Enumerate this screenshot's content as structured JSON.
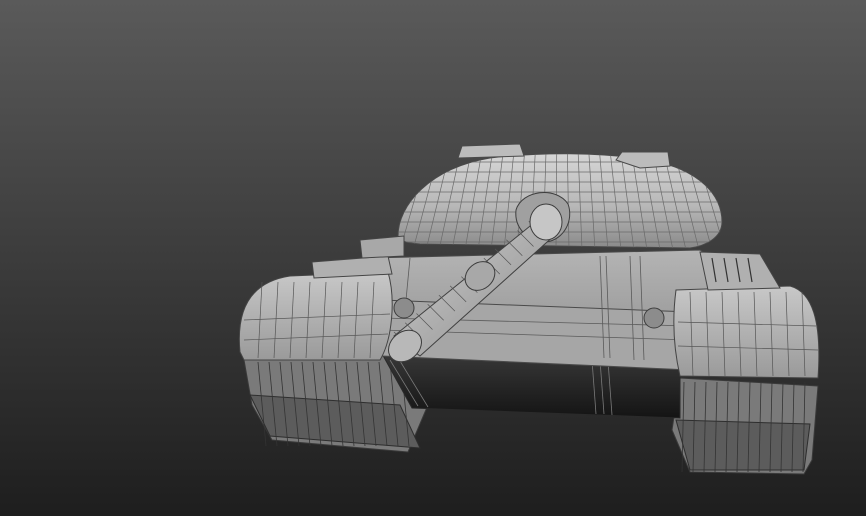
{
  "viewport": {
    "background_top": "#5a5a5a",
    "background_bottom": "#1e1e1e",
    "mode": "perspective",
    "shading": "smooth-shaded-with-wireframe-edges"
  },
  "model": {
    "object": "tank",
    "colors": {
      "surface_light": "#c4c4c4",
      "surface_mid": "#9c9c9c",
      "surface_dark": "#6e6e6e",
      "shadow": "#1c1c1c",
      "wire": "#3a3a3a"
    }
  }
}
